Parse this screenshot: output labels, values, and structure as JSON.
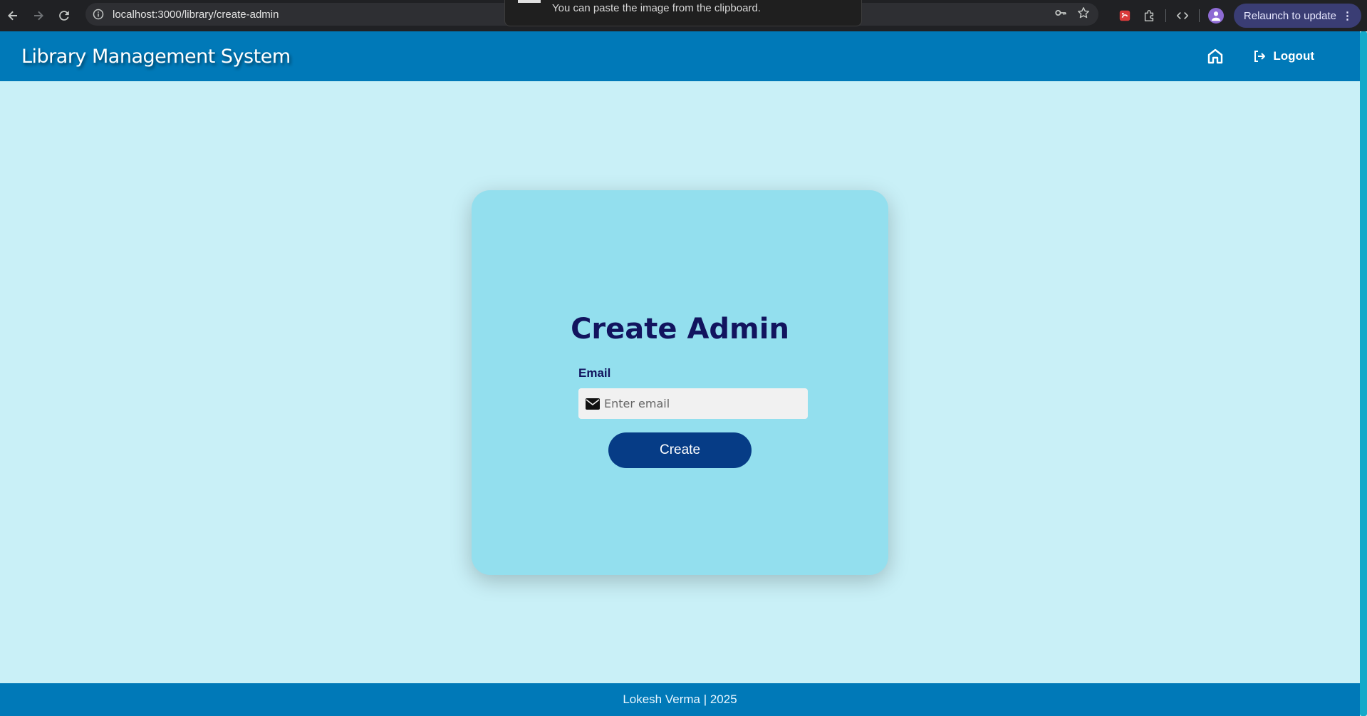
{
  "browser": {
    "url": "localhost:3000/library/create-admin",
    "relaunch_label": "Relaunch to update",
    "toast_text": "You can paste the image from the clipboard."
  },
  "header": {
    "brand": "Library Management System",
    "logout_label": "Logout"
  },
  "form": {
    "title": "Create Admin",
    "email_label": "Email",
    "email_placeholder": "Enter email",
    "email_value": "",
    "submit_label": "Create"
  },
  "footer": {
    "text": "Lokesh Verma | 2025"
  },
  "colors": {
    "page_bg": "#c9f0f7",
    "header_bg": "#0079b8",
    "card_bg": "#93dfee",
    "title_color": "#12145e",
    "button_bg": "#063c86"
  },
  "icons": [
    "back-icon",
    "forward-icon",
    "reload-icon",
    "info-icon",
    "key-icon",
    "star-icon",
    "extension-icon",
    "puzzle-icon",
    "code-icon",
    "profile-icon",
    "home-icon",
    "logout-icon",
    "envelope-icon"
  ]
}
